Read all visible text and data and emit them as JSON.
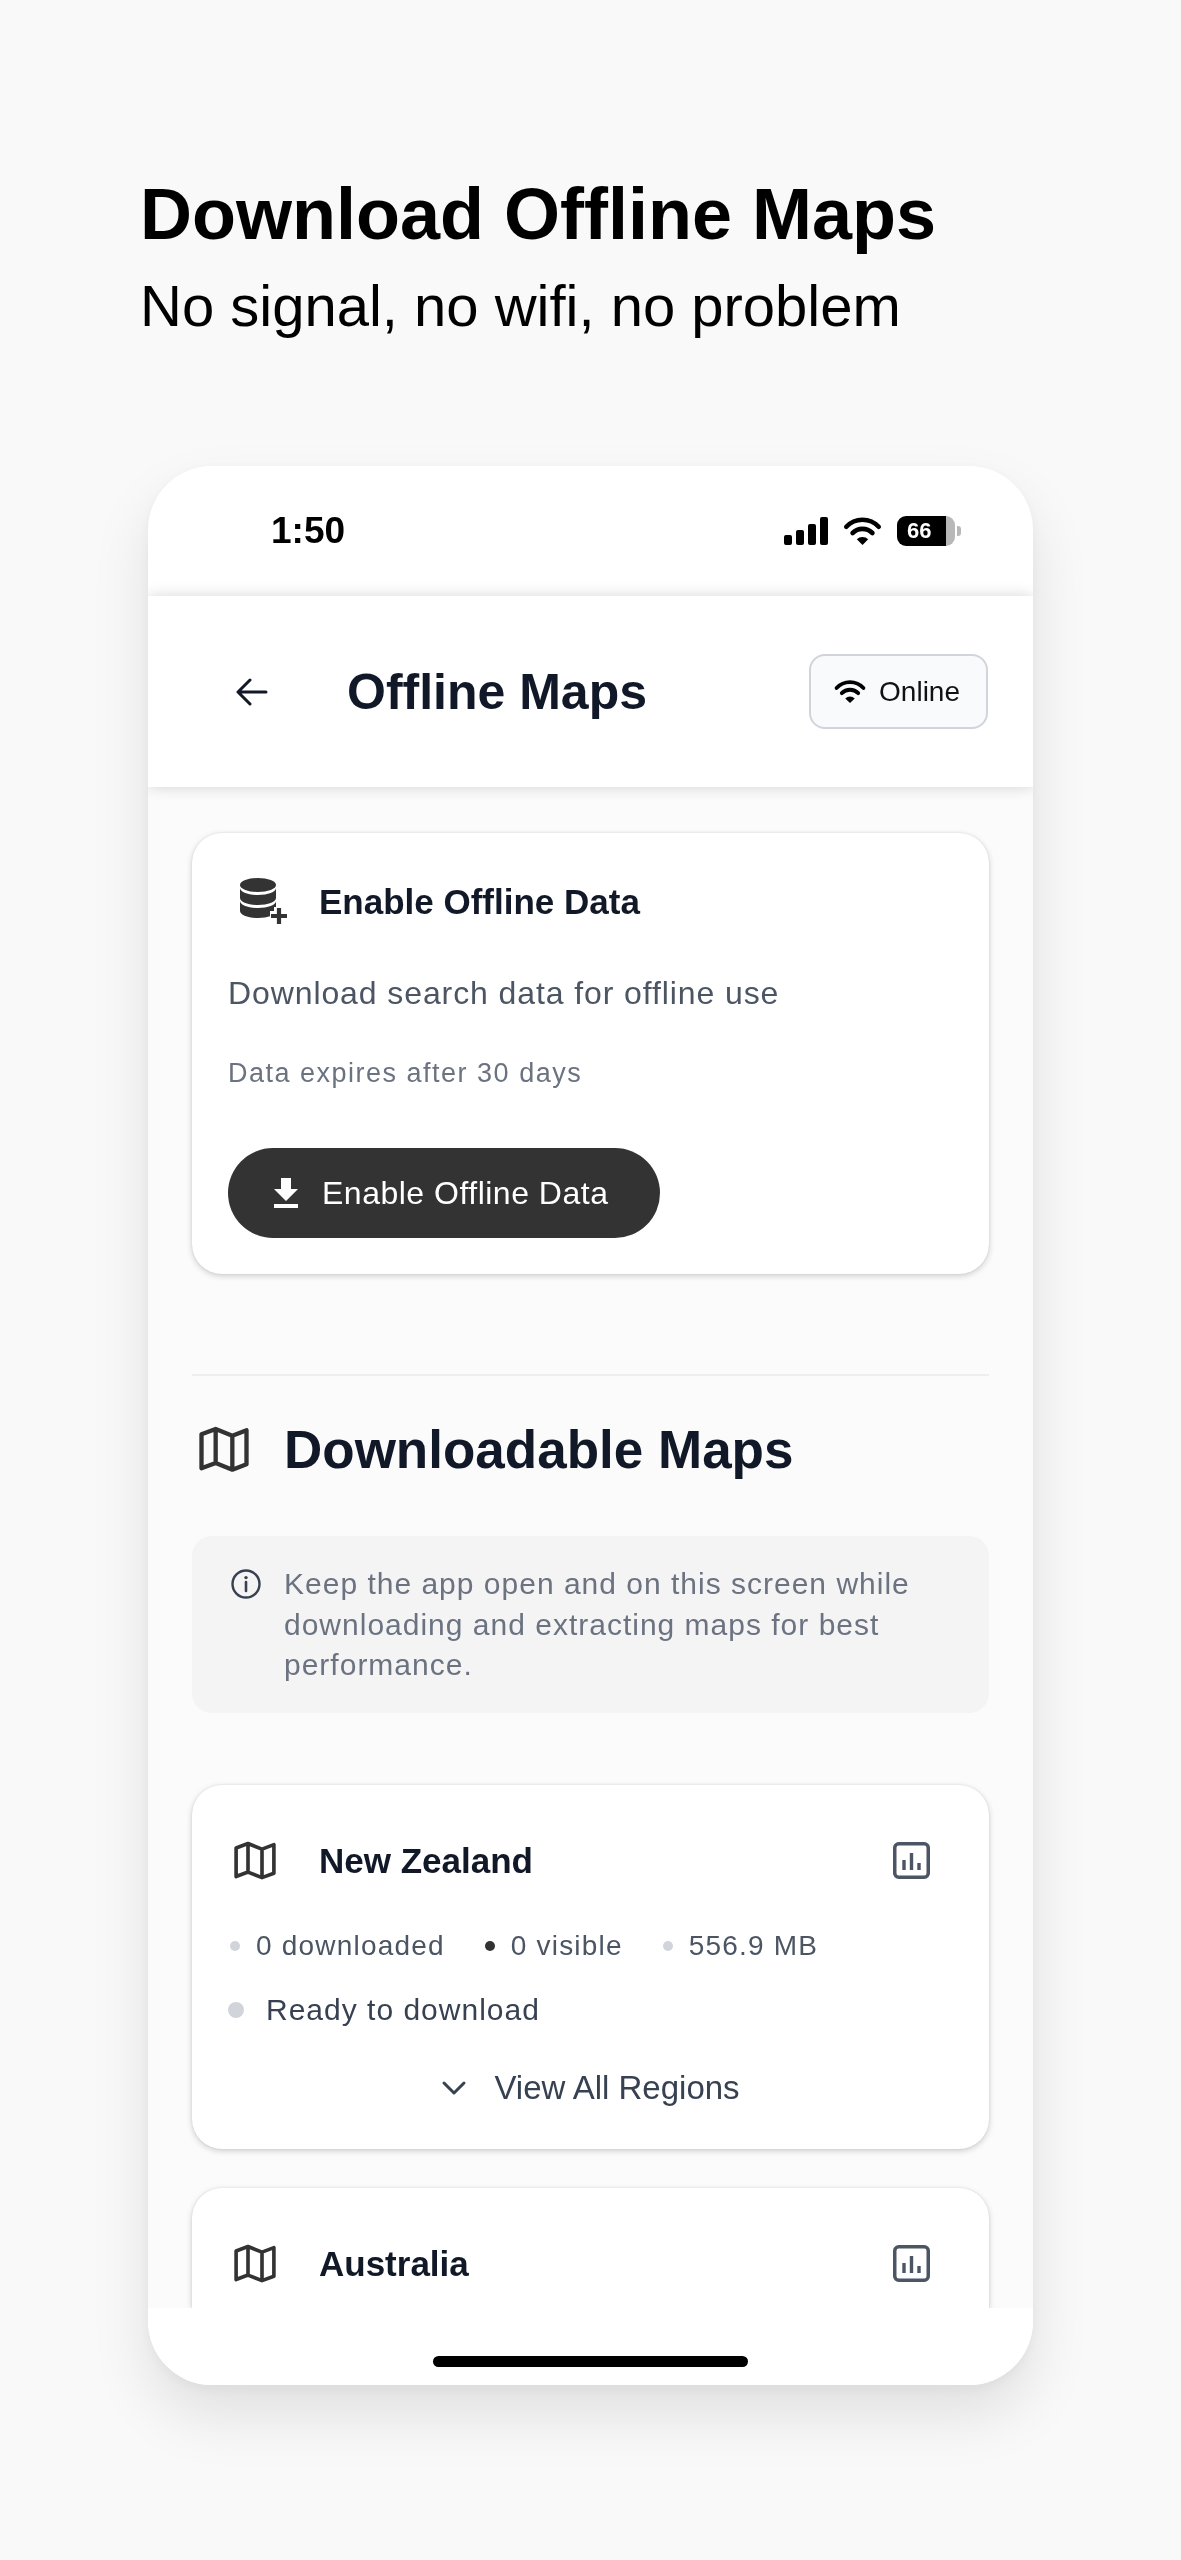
{
  "headline": {
    "title": "Download Offline Maps",
    "subtitle": "No signal, no wifi, no problem"
  },
  "status_bar": {
    "time": "1:50",
    "battery": "66"
  },
  "header": {
    "title": "Offline Maps",
    "connection": "Online"
  },
  "offline_card": {
    "title": "Enable Offline Data",
    "description": "Download search data for offline use",
    "note": "Data expires after 30 days",
    "button": "Enable Offline Data"
  },
  "downloadable_maps": {
    "title": "Downloadable Maps",
    "info": "Keep the app open and on this screen while downloading and extracting maps for best performance.",
    "maps": [
      {
        "name": "New Zealand",
        "stats": [
          {
            "label": "0 downloaded",
            "color": "#d1d5db"
          },
          {
            "label": "0 visible",
            "color": "#333333"
          },
          {
            "label": "556.9 MB",
            "color": "#d1d5db"
          }
        ],
        "status": {
          "label": "Ready to download",
          "color": "#d1d5db"
        },
        "toggle": {
          "label": "View All Regions",
          "expanded": false
        }
      },
      {
        "name": "Australia"
      }
    ]
  }
}
